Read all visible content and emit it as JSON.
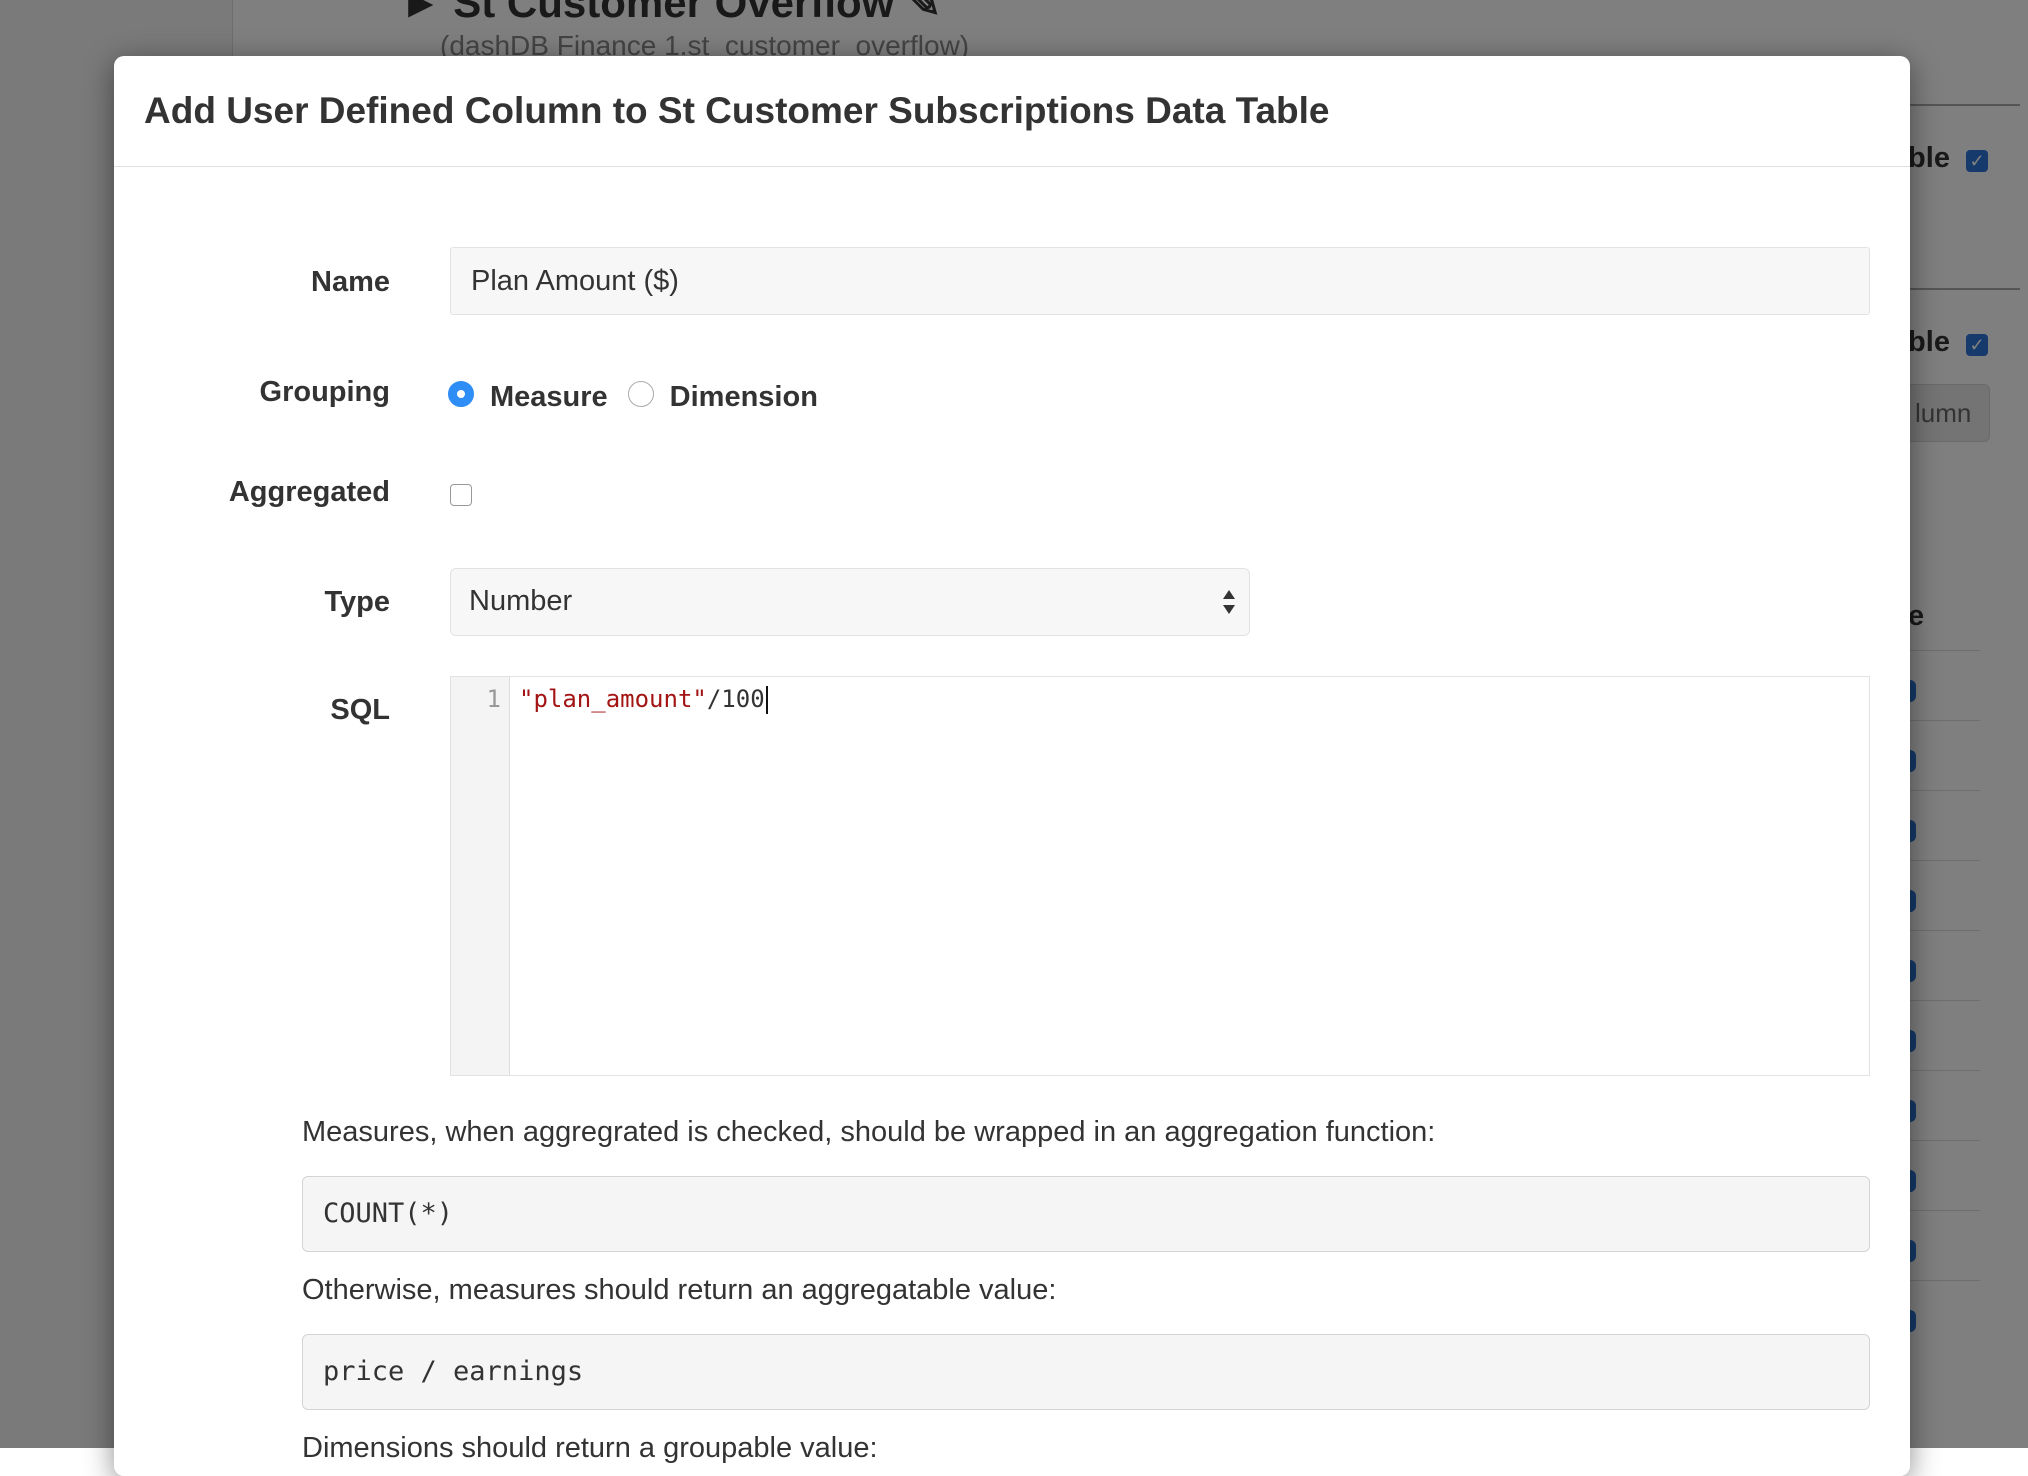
{
  "background": {
    "page_title": "► St Customer Overflow ✎",
    "page_subtitle": "(dashDB Finance 1.st_customer_overflow)",
    "visible_label": "ible",
    "add_column_label": "lumn",
    "column_header": "le"
  },
  "modal": {
    "title": "Add User Defined Column to St Customer Subscriptions Data Table",
    "name": {
      "label": "Name",
      "value": "Plan Amount ($)"
    },
    "grouping": {
      "label": "Grouping",
      "options": [
        "Measure",
        "Dimension"
      ],
      "selected": "Measure"
    },
    "aggregated": {
      "label": "Aggregated",
      "checked": false
    },
    "type": {
      "label": "Type",
      "value": "Number"
    },
    "sql": {
      "label": "SQL",
      "line_number": "1",
      "code_string": "\"plan_amount\"",
      "code_rest": "/100"
    },
    "help": {
      "aggregated_text": "Measures, when aggregrated is checked, should be wrapped in an aggregation function:",
      "aggregated_example": "COUNT(*)",
      "measures_text": "Otherwise, measures should return an aggregatable value:",
      "measures_example": "price / earnings",
      "dimensions_text": "Dimensions should return a groupable value:"
    }
  },
  "colors": {
    "accent": "#2e8ef5",
    "checkbox_blue": "#2b74d6",
    "sql_string": "#a31515"
  }
}
